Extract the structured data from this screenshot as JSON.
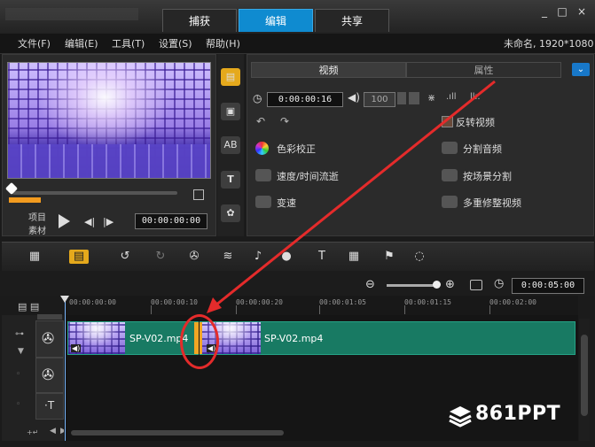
{
  "tabs": [
    "捕获",
    "编辑",
    "共享"
  ],
  "active_tab": "编辑",
  "window_controls": [
    "_",
    "□",
    "×"
  ],
  "menu": [
    "文件(F)",
    "编辑(E)",
    "工具(T)",
    "设置(S)",
    "帮助(H)"
  ],
  "project_info": "未命名, 1920*1080",
  "preview": {
    "mode_project": "项目",
    "mode_clip": "素材",
    "timecode": "00:00:00:00"
  },
  "options": {
    "tab_video": "视频",
    "tab_properties": "属性",
    "duration": "0:00:00:16",
    "volume": "100",
    "left_items": [
      "色彩校正",
      "速度/时间流逝",
      "变速"
    ],
    "right_items": [
      "反转视频",
      "分割音频",
      "按场景分割",
      "多重修整视频"
    ]
  },
  "timeline": {
    "project_duration": "0:00:05:00",
    "ruler_ticks": [
      "00:00:00:00",
      "00:00:00:10",
      "00:00:00:20",
      "00:00:01:05",
      "00:00:01:15",
      "00:00:02:00"
    ],
    "clips": [
      "SP-V02.mp4",
      "SP-V02.mp4"
    ]
  },
  "watermark": "861PPT",
  "colors": {
    "active_tab": "#0f8bd0",
    "clip": "#187a63",
    "trim_handle": "#f2a623",
    "annotation": "#e42b2b"
  }
}
